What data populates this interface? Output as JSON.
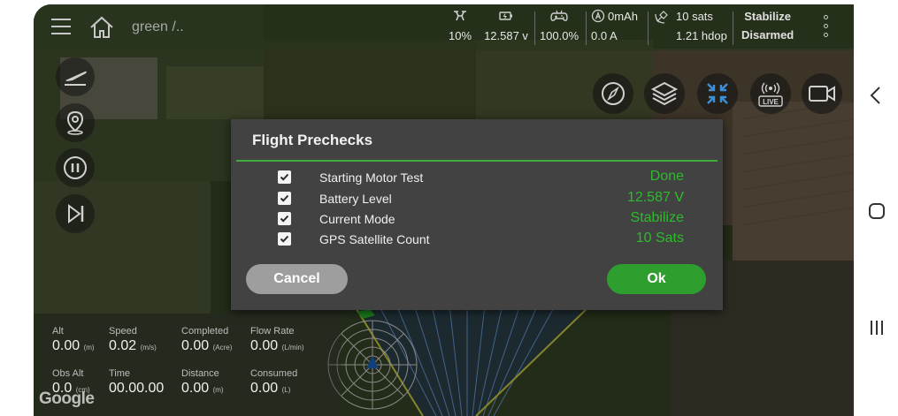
{
  "topbar": {
    "mission_name": "green /..",
    "stats": [
      {
        "icon": "drone-icon",
        "value": "10%"
      },
      {
        "icon": "battery-icon",
        "value": "12.587 v"
      },
      {
        "icon": "gamepad-icon",
        "value": "100.0%"
      },
      {
        "icon": "amp-icon",
        "top": "0mAh",
        "value": "0.0 A"
      },
      {
        "icon": "satellite-icon",
        "top": "10 sats",
        "value": "1.21 hdop"
      }
    ],
    "mode": "Stabilize",
    "arm_state": "Disarmed"
  },
  "telemetry": {
    "cells": [
      {
        "label": "Alt",
        "value": "0.00",
        "unit": "(m)"
      },
      {
        "label": "Speed",
        "value": "0.02",
        "unit": "(m/s)"
      },
      {
        "label": "Completed",
        "value": "0.00",
        "unit": "(Acre)"
      },
      {
        "label": "Flow Rate",
        "value": "0.00",
        "unit": "(L/min)"
      },
      {
        "label": "Obs Alt",
        "value": "0.0",
        "unit": "(cm)"
      },
      {
        "label": "Time",
        "value": "00.00.00",
        "unit": ""
      },
      {
        "label": "Distance",
        "value": "0.00",
        "unit": "(m)"
      },
      {
        "label": "Consumed",
        "value": "0.00",
        "unit": "(L)"
      }
    ]
  },
  "map": {
    "attribution": "Google"
  },
  "dialog": {
    "title": "Flight Prechecks",
    "checks": [
      {
        "label": "Starting Motor Test",
        "value": "Done",
        "checked": true
      },
      {
        "label": "Battery Level",
        "value": "12.587 V",
        "checked": true
      },
      {
        "label": "Current Mode",
        "value": "Stabilize",
        "checked": true
      },
      {
        "label": "GPS Satellite Count",
        "value": "10 Sats",
        "checked": true
      }
    ],
    "cancel_label": "Cancel",
    "ok_label": "Ok"
  },
  "colors": {
    "accent_green": "#2dbb2d",
    "ok_button": "#2e9e2e",
    "cancel_button": "#9e9e9e",
    "dialog_bg": "#424242"
  }
}
